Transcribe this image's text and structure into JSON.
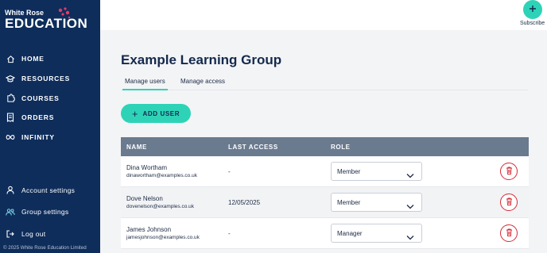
{
  "brand": {
    "line1": "White Rose",
    "line2": "EDUCATION",
    "copyright": "© 2025 White Rose Education Limited"
  },
  "nav": {
    "items": [
      {
        "label": "HOME",
        "icon": "home-icon"
      },
      {
        "label": "RESOURCES",
        "icon": "graduation-cap-icon"
      },
      {
        "label": "COURSES",
        "icon": "puzzle-icon"
      },
      {
        "label": "ORDERS",
        "icon": "receipt-icon"
      },
      {
        "label": "INFINITY",
        "icon": "infinity-icon"
      }
    ],
    "bottom": [
      {
        "label": "Account settings",
        "icon": "user-icon"
      },
      {
        "label": "Group settings",
        "icon": "group-icon"
      },
      {
        "label": "Log out",
        "icon": "logout-icon"
      }
    ]
  },
  "header": {
    "subscribe_label": "Subscribe"
  },
  "main": {
    "title": "Example Learning Group",
    "tabs": [
      {
        "label": "Manage users",
        "active": true
      },
      {
        "label": "Manage access",
        "active": false
      }
    ],
    "add_user_label": "ADD USER",
    "columns": [
      "NAME",
      "LAST ACCESS",
      "ROLE"
    ],
    "users": [
      {
        "name": "Dina Wortham",
        "email": "dinawortham@examples.co.uk",
        "last_access": "-",
        "role": "Member"
      },
      {
        "name": "Dove Nelson",
        "email": "dovenelson@examples.co.uk",
        "last_access": "12/05/2025",
        "role": "Member"
      },
      {
        "name": "James Johnson",
        "email": "jamesjohnson@examples.co.uk",
        "last_access": "-",
        "role": "Manager"
      }
    ]
  },
  "colors": {
    "sidebar": "#0e2d5b",
    "accent": "#2ed3b7",
    "table_header": "#6a7a8f",
    "delete": "#d42a35"
  }
}
